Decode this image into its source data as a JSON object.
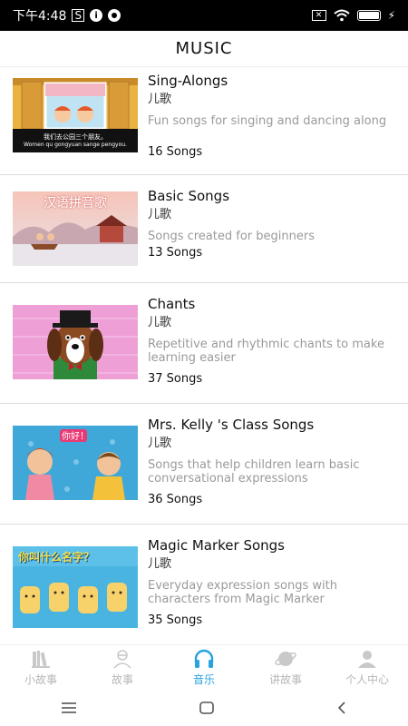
{
  "status": {
    "time": "下午4:48",
    "icons": [
      "sim-icon",
      "info-icon",
      "record-icon"
    ],
    "right_icons": [
      "no-sim-icon",
      "wifi-icon",
      "battery-icon",
      "charging-icon"
    ]
  },
  "header": {
    "title": "MUSIC"
  },
  "items": [
    {
      "title": "Sing-Alongs",
      "tag": "儿歌",
      "desc": "Fun songs for singing and dancing along",
      "count": "16 Songs",
      "thumb_caption": "我们去公园三个朋友。",
      "thumb_caption2": "Women qu gongyuan sange pengyou."
    },
    {
      "title": "Basic Songs",
      "tag": "儿歌",
      "desc": "Songs created for beginners",
      "count": "13 Songs",
      "thumb_caption": "汉语拼音歌"
    },
    {
      "title": "Chants",
      "tag": "儿歌",
      "desc": "Repetitive and rhythmic chants to make learning easier",
      "count": "37 Songs"
    },
    {
      "title": "Mrs. Kelly 's Class Songs",
      "tag": "儿歌",
      "desc": "Songs that help children learn basic conversational expressions",
      "count": "36 Songs",
      "thumb_caption": "你好！"
    },
    {
      "title": "Magic Marker Songs",
      "tag": "儿歌",
      "desc": "Everyday expression songs with characters from Magic Marker",
      "count": "35 Songs",
      "thumb_caption": "你叫什么名字？"
    }
  ],
  "tabs": [
    {
      "label": "小故事",
      "icon": "books-icon"
    },
    {
      "label": "故事",
      "icon": "person-icon"
    },
    {
      "label": "音乐",
      "icon": "headphones-icon"
    },
    {
      "label": "讲故事",
      "icon": "planet-icon"
    },
    {
      "label": "个人中心",
      "icon": "profile-icon"
    }
  ],
  "active_tab": 2,
  "colors": {
    "accent": "#29a3e0",
    "inactive": "#b7b7b7"
  }
}
